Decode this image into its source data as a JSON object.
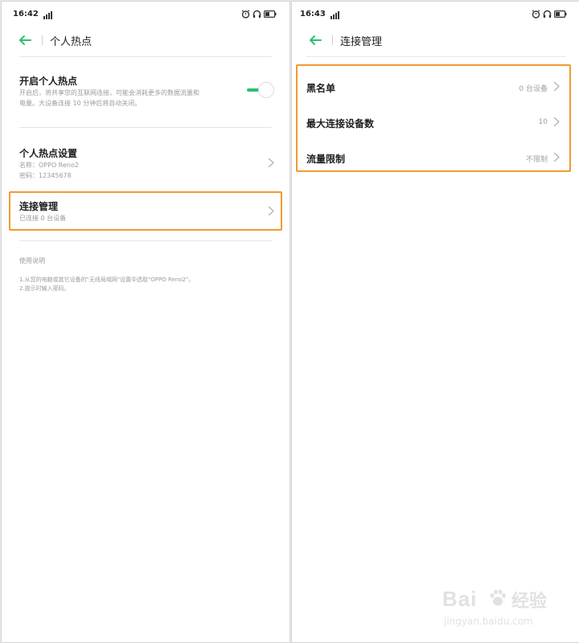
{
  "colors": {
    "accent_green": "#2fbf71",
    "highlight_orange": "#f29a2e"
  },
  "left_screen": {
    "status": {
      "time": "16:42"
    },
    "nav": {
      "title": "个人热点"
    },
    "hotspot_toggle": {
      "title": "开启个人热点",
      "description_line1": "开启后，将共享您的互联网连接，可能会消耗更多的数据流量和",
      "description_line2": "电量。大设备连接 10 分钟后将自动关闭。",
      "enabled": true
    },
    "hotspot_settings": {
      "title": "个人热点设置",
      "name_line": "名称：OPPO Reno2",
      "password_line": "密码：12345678"
    },
    "connection_management": {
      "title": "连接管理",
      "subtitle": "已连接 0 台设备"
    },
    "instructions": {
      "title": "使用说明",
      "line1": "1.从您的电脑或其它设备的\"无线局域网\"设置中选取\"OPPO Reno2\"。",
      "line2": "2.提示时输入密码。"
    }
  },
  "right_screen": {
    "status": {
      "time": "16:43"
    },
    "nav": {
      "title": "连接管理"
    },
    "items": [
      {
        "label": "黑名单",
        "value": "0 台设备"
      },
      {
        "label": "最大连接设备数",
        "value": "10"
      },
      {
        "label": "流量限制",
        "value": "不限制"
      }
    ]
  },
  "watermark": {
    "brand": "Bai",
    "brand_suffix": "经验",
    "url": "jingyan.baidu.com",
    "icon": "paw-icon"
  }
}
